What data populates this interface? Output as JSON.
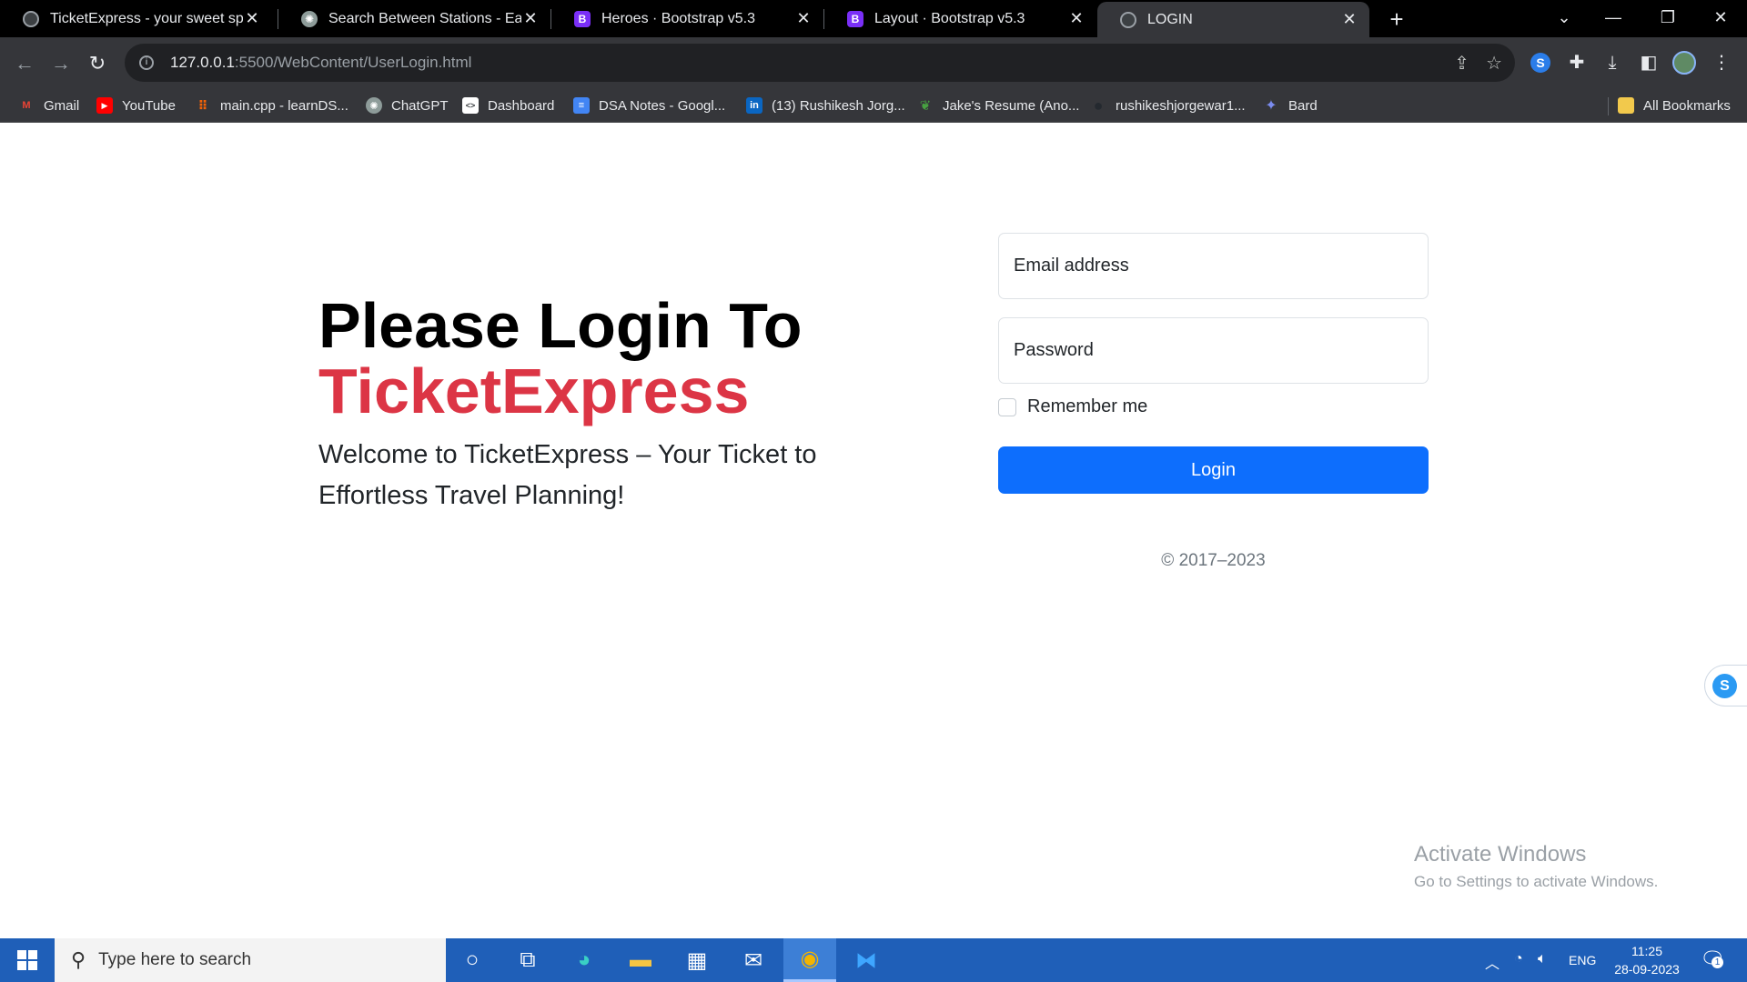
{
  "browser": {
    "tabs": [
      {
        "title": "TicketExpress - your sweet spot",
        "favicon": "globe-icon",
        "active": false
      },
      {
        "title": "Search Between Stations - Easy",
        "favicon": "chatgpt-icon",
        "active": false
      },
      {
        "title": "Heroes · Bootstrap v5.3",
        "favicon": "bootstrap-icon",
        "active": false
      },
      {
        "title": "Layout · Bootstrap v5.3",
        "favicon": "bootstrap-icon",
        "active": false
      },
      {
        "title": "LOGIN",
        "favicon": "globe-icon",
        "active": true
      }
    ],
    "close_glyph": "✕",
    "new_tab_glyph": "+",
    "address": {
      "host": "127.0.0.1",
      "path": ":5500/WebContent/UserLogin.html"
    },
    "bookmarks": [
      {
        "label": "Gmail",
        "icon": "gmail-icon",
        "glyph": "M",
        "color": "#ea4335"
      },
      {
        "label": "YouTube",
        "icon": "youtube-icon",
        "glyph": "▶",
        "color": "#ff0000"
      },
      {
        "label": "main.cpp - learnDS...",
        "icon": "replit-icon",
        "glyph": "⠿",
        "color": "#f26207"
      },
      {
        "label": "ChatGPT",
        "icon": "chatgpt-icon",
        "glyph": "✺",
        "color": "#8e9c9a"
      },
      {
        "label": "Dashboard",
        "icon": "dashboard-icon",
        "glyph": "<>",
        "color": "#ffffff"
      },
      {
        "label": "DSA Notes - Googl...",
        "icon": "google-docs-icon",
        "glyph": "≡",
        "color": "#4285f4"
      },
      {
        "label": "(13) Rushikesh Jorg...",
        "icon": "linkedin-icon",
        "glyph": "in",
        "color": "#0a66c2"
      },
      {
        "label": "Jake's Resume (Ano...",
        "icon": "overleaf-icon",
        "glyph": "❦",
        "color": "#47a141"
      },
      {
        "label": "rushikeshjorgewar1...",
        "icon": "github-icon",
        "glyph": "●",
        "color": "#24292f"
      },
      {
        "label": "Bard",
        "icon": "bard-icon",
        "glyph": "✦",
        "color": "#7b8cf0"
      }
    ],
    "all_bookmarks": "All Bookmarks"
  },
  "page": {
    "heading_line1": "Please Login To",
    "heading_brand": "TicketExpress",
    "lead": "Welcome to TicketExpress – Your Ticket to Effortless Travel Planning!",
    "email_placeholder": "Email address",
    "password_placeholder": "Password",
    "remember_label": "Remember me",
    "login_label": "Login",
    "copyright": "© 2017–2023",
    "brand_color": "#dc3545",
    "primary_color": "#0d6efd"
  },
  "watermark": {
    "title": "Activate Windows",
    "subtitle": "Go to Settings to activate Windows."
  },
  "taskbar": {
    "search_placeholder": "Type here to search",
    "language": "ENG",
    "time": "11:25",
    "date": "28-09-2023",
    "notification_count": "1"
  }
}
